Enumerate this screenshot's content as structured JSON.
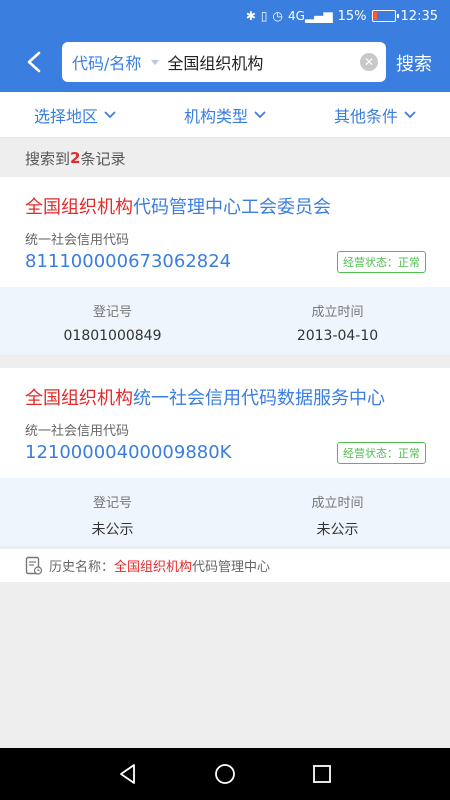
{
  "status_bar": {
    "battery_percent": "15%",
    "time": "12:35",
    "icons": [
      "bluetooth-icon",
      "vibrate-icon",
      "alarm-icon",
      "4g-signal-icon",
      "battery-icon"
    ],
    "network_label": "4G"
  },
  "header": {
    "search_type": "代码/名称",
    "query": "全国组织机构",
    "search_label": "搜索"
  },
  "filters": [
    {
      "label": "选择地区"
    },
    {
      "label": "机构类型"
    },
    {
      "label": "其他条件"
    }
  ],
  "results_summary": {
    "prefix": "搜索到",
    "count": "2",
    "suffix": "条记录"
  },
  "results": [
    {
      "name_highlight": "全国组织机构",
      "name_rest": "代码管理中心工会委员会",
      "code_label": "统一社会信用代码",
      "code": "81110000067306282 4",
      "status": "经营状态：正常",
      "reg_no_label": "登记号",
      "reg_no": "01801000849",
      "established_label": "成立时间",
      "established": "2013-04-10"
    },
    {
      "name_highlight": "全国组织机构",
      "name_rest": "统一社会信用代码数据服务中心",
      "code_label": "统一社会信用代码",
      "code": "12100000400009880K",
      "status": "经营状态：正常",
      "reg_no_label": "登记号",
      "reg_no": "未公示",
      "established_label": "成立时间",
      "established": "未公示",
      "history_label": "历史名称：",
      "history_highlight": "全国组织机构",
      "history_rest": "代码管理中心"
    }
  ],
  "colors": {
    "primary": "#3a7ee0",
    "highlight": "#e52a2a",
    "status_green": "#4fbf4f"
  }
}
